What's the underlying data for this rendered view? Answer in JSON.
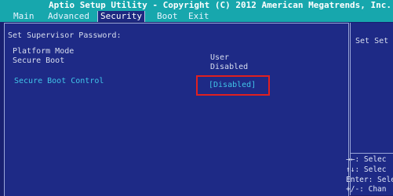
{
  "header": {
    "title": "Aptio Setup Utility - Copyright (C) 2012 American Megatrends, Inc."
  },
  "tabs": [
    {
      "label": "Main"
    },
    {
      "label": "Advanced"
    },
    {
      "label": "Security"
    },
    {
      "label": "Boot"
    },
    {
      "label": "Exit"
    }
  ],
  "active_tab": "Security",
  "content": {
    "supervisor_password_label": "Set Supervisor Password:",
    "platform_mode_label": "Platform Mode",
    "platform_mode_value": "User",
    "secure_boot_label": "Secure Boot",
    "secure_boot_value": "Disabled",
    "secure_boot_control_label": "Secure Boot Control",
    "secure_boot_control_value": "[Disabled]"
  },
  "help_panel": {
    "description": "Set Set",
    "keys": [
      "→←: Selec",
      "↑↓: Selec",
      "Enter: Selec",
      "+/-: Chan"
    ]
  },
  "colors": {
    "header_bg": "#17a7ad",
    "panel_bg": "#1e2a86",
    "highlight_border": "#e02020",
    "option_text": "#41c5e8"
  }
}
